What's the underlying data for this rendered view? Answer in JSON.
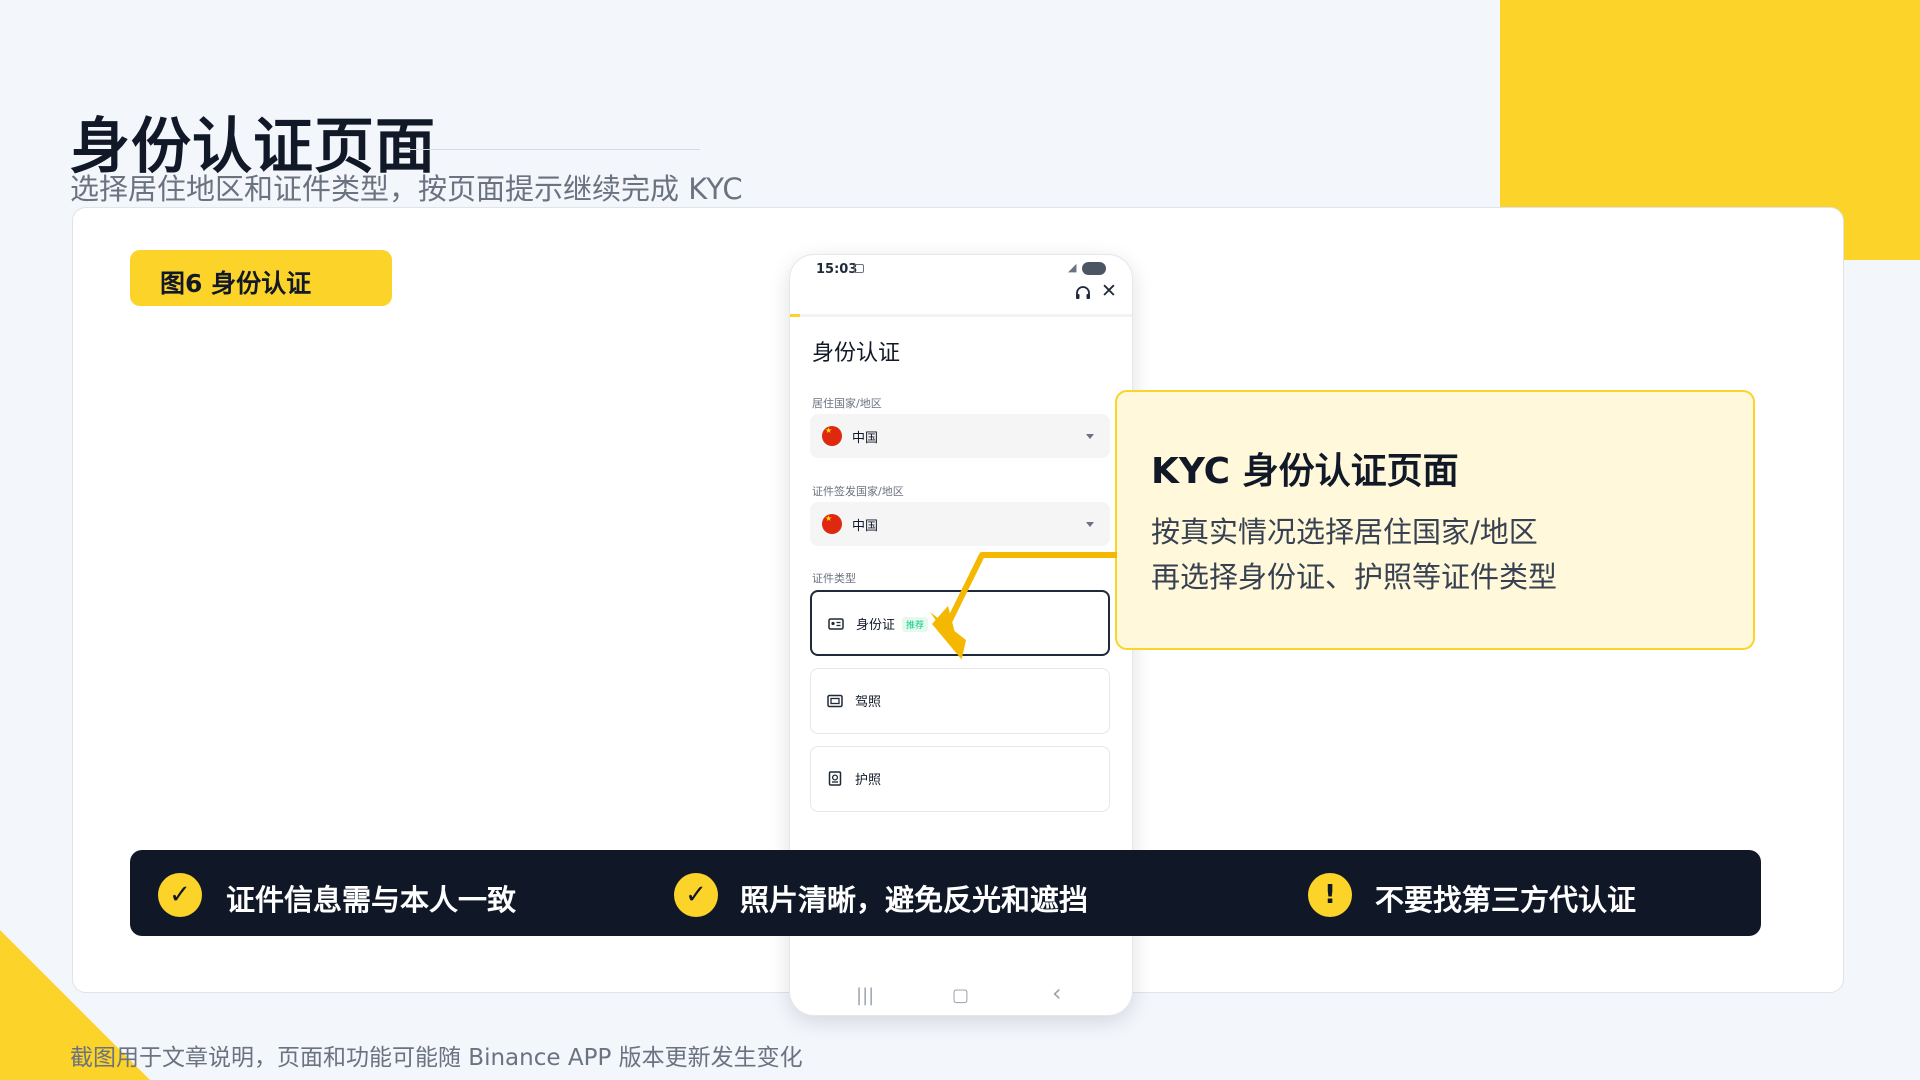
{
  "slide": {
    "title": "身份认证页面",
    "subtitle": "选择居住地区和证件类型，按页面提示继续完成 KYC",
    "figure_tag": "图6 身份认证",
    "footnote": "截图用于文章说明，页面和功能可能随 Binance APP 版本更新发生变化",
    "colors": {
      "accent": "#fcd329",
      "dark": "#101828",
      "background": "#f3f6fb"
    }
  },
  "phone": {
    "status": {
      "time": "15:03",
      "battery_icon": "battery-icon"
    },
    "progress_fraction": 0.03,
    "heading": "身份认证",
    "residence": {
      "label": "居住国家/地区",
      "value": "中国",
      "flag_icon": "cn-flag-icon"
    },
    "issuer": {
      "label": "证件签发国家/地区",
      "value": "中国",
      "flag_icon": "cn-flag-icon"
    },
    "doc_type_label": "证件类型",
    "documents": [
      {
        "label": "身份证",
        "badge": "推荐",
        "icon": "id-card-icon",
        "selected": true
      },
      {
        "label": "驾照",
        "badge": "",
        "icon": "license-icon",
        "selected": false
      },
      {
        "label": "护照",
        "badge": "",
        "icon": "passport-icon",
        "selected": false
      }
    ],
    "nav": {
      "recents": "|||",
      "home": "▢",
      "back": "‹"
    }
  },
  "callout": {
    "title": "KYC 身份认证页面",
    "lines": [
      "按真实情况选择居住国家/地区",
      "再选择身份证、护照等证件类型"
    ]
  },
  "tips": [
    {
      "icon": "check-icon",
      "glyph": "✓",
      "text": "证件信息需与本人一致"
    },
    {
      "icon": "check-icon",
      "glyph": "✓",
      "text": "照片清晰，避免反光和遮挡"
    },
    {
      "icon": "warning-icon",
      "glyph": "!",
      "text": "不要找第三方代认证"
    }
  ]
}
